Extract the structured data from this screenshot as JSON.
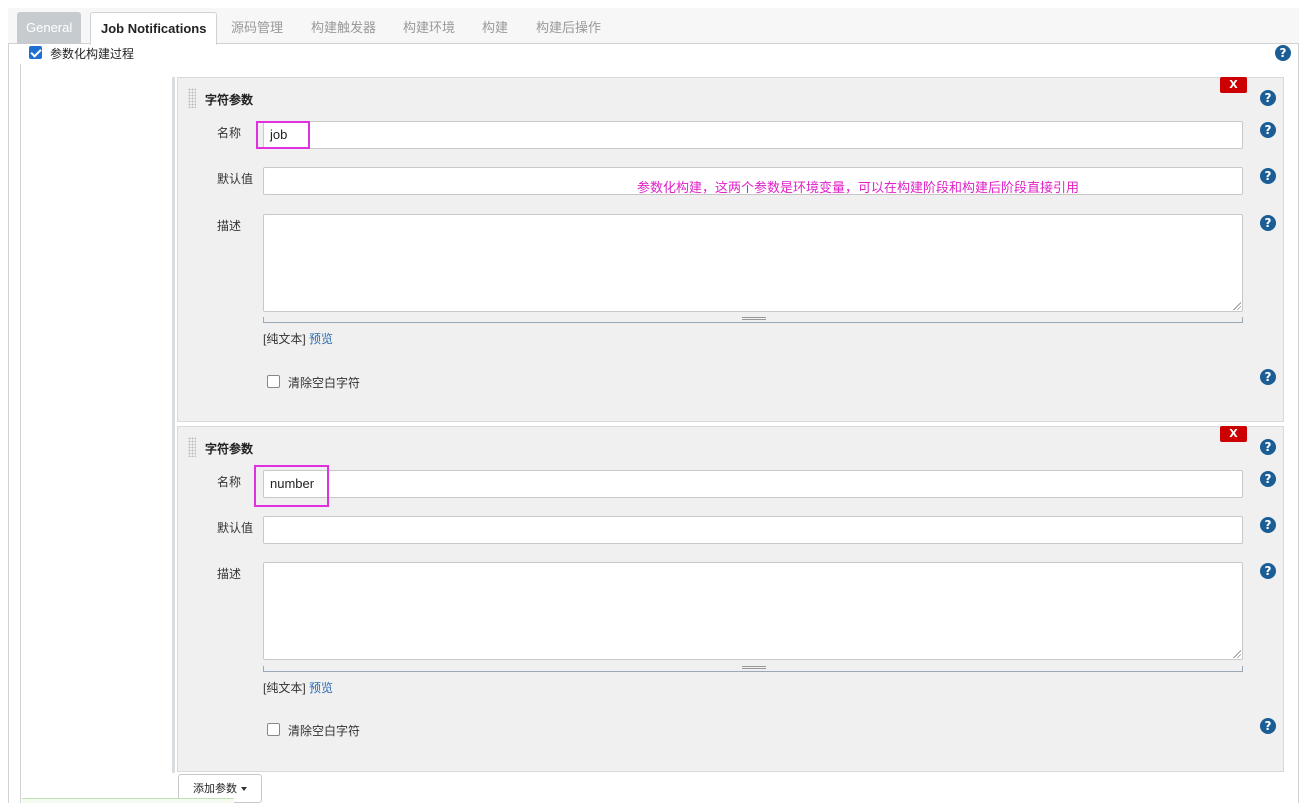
{
  "tabs": [
    {
      "label": "General"
    },
    {
      "label": "Job Notifications"
    },
    {
      "label": "源码管理"
    },
    {
      "label": "构建触发器"
    },
    {
      "label": "构建环境"
    },
    {
      "label": "构建"
    },
    {
      "label": "构建后操作"
    }
  ],
  "param_build": {
    "label": "参数化构建过程",
    "checked": true
  },
  "help_glyph": "?",
  "delete_glyph": "X",
  "params": [
    {
      "type_label": "字符参数",
      "name_label": "名称",
      "name_value": "job",
      "default_label": "默认值",
      "default_value": "",
      "desc_label": "描述",
      "format_label": "[纯文本]",
      "preview_label": "预览",
      "trim_label": "清除空白字符",
      "trim_checked": false
    },
    {
      "type_label": "字符参数",
      "name_label": "名称",
      "name_value": "number",
      "default_label": "默认值",
      "default_value": "",
      "desc_label": "描述",
      "format_label": "[纯文本]",
      "preview_label": "预览",
      "trim_label": "清除空白字符",
      "trim_checked": false
    }
  ],
  "annotation": "参数化构建，这两个参数是环境变量，可以在构建阶段和构建后阶段直接引用",
  "add_param_button": "添加参数",
  "colors": {
    "highlight": "#e030e0",
    "annotation": "#e020c8",
    "help": "#1a5e95",
    "delete": "#cc0000"
  }
}
